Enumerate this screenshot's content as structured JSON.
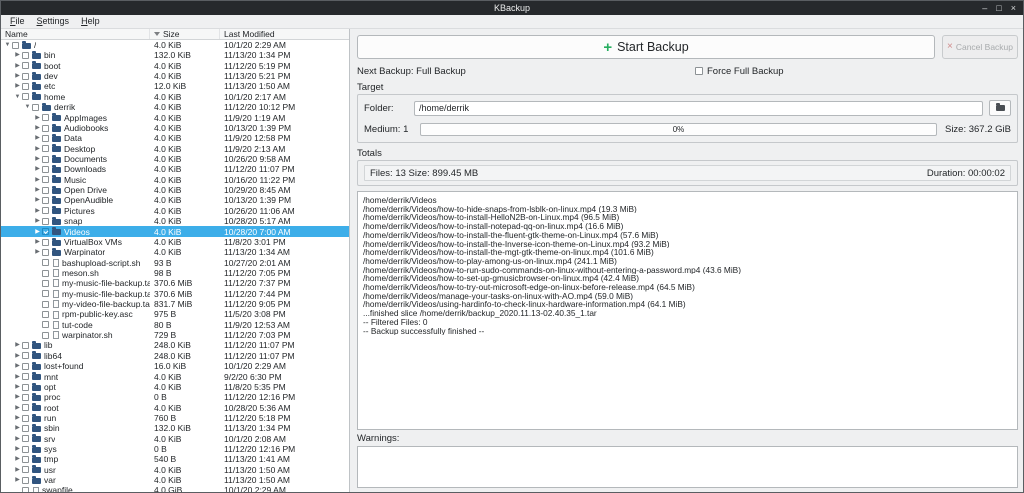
{
  "window": {
    "title": "KBackup",
    "controls": {
      "minimize": "–",
      "maximize": "□",
      "close": "×"
    }
  },
  "menu": {
    "items": [
      "File",
      "Settings",
      "Help"
    ]
  },
  "icons": {
    "plus": "+",
    "cancel_x": "×",
    "open_arrow": "▼",
    "closed_arrow": "▶"
  },
  "tree": {
    "columns": {
      "name": "Name",
      "size": "Size",
      "modified": "Last Modified"
    },
    "rows": [
      {
        "name": "/",
        "size": "4.0 KiB",
        "modified": "10/1/20 2:29 AM",
        "depth": 0,
        "arrow": "open",
        "kind": "dir",
        "checked": false,
        "selected": false
      },
      {
        "name": "bin",
        "size": "132.0 KiB",
        "modified": "11/13/20 1:34 PM",
        "depth": 1,
        "arrow": "closed",
        "kind": "dir",
        "checked": false,
        "selected": false
      },
      {
        "name": "boot",
        "size": "4.0 KiB",
        "modified": "11/12/20 5:19 PM",
        "depth": 1,
        "arrow": "closed",
        "kind": "dir",
        "checked": false,
        "selected": false
      },
      {
        "name": "dev",
        "size": "4.0 KiB",
        "modified": "11/13/20 5:21 PM",
        "depth": 1,
        "arrow": "closed",
        "kind": "dir",
        "checked": false,
        "selected": false
      },
      {
        "name": "etc",
        "size": "12.0 KiB",
        "modified": "11/13/20 1:50 AM",
        "depth": 1,
        "arrow": "closed",
        "kind": "dir",
        "checked": false,
        "selected": false
      },
      {
        "name": "home",
        "size": "4.0 KiB",
        "modified": "10/1/20 2:17 AM",
        "depth": 1,
        "arrow": "open",
        "kind": "dir",
        "checked": false,
        "selected": false
      },
      {
        "name": "derrik",
        "size": "4.0 KiB",
        "modified": "11/12/20 10:12 PM",
        "depth": 2,
        "arrow": "open",
        "kind": "dir",
        "checked": false,
        "selected": false
      },
      {
        "name": "AppImages",
        "size": "4.0 KiB",
        "modified": "11/9/20 1:19 AM",
        "depth": 3,
        "arrow": "closed",
        "kind": "dir",
        "checked": false,
        "selected": false
      },
      {
        "name": "Audiobooks",
        "size": "4.0 KiB",
        "modified": "10/13/20 1:39 PM",
        "depth": 3,
        "arrow": "closed",
        "kind": "dir",
        "checked": false,
        "selected": false
      },
      {
        "name": "Data",
        "size": "4.0 KiB",
        "modified": "11/9/20 12:58 PM",
        "depth": 3,
        "arrow": "closed",
        "kind": "dir",
        "checked": false,
        "selected": false
      },
      {
        "name": "Desktop",
        "size": "4.0 KiB",
        "modified": "11/9/20 2:13 AM",
        "depth": 3,
        "arrow": "closed",
        "kind": "dir",
        "checked": false,
        "selected": false
      },
      {
        "name": "Documents",
        "size": "4.0 KiB",
        "modified": "10/26/20 9:58 AM",
        "depth": 3,
        "arrow": "closed",
        "kind": "dir",
        "checked": false,
        "selected": false
      },
      {
        "name": "Downloads",
        "size": "4.0 KiB",
        "modified": "11/12/20 11:07 PM",
        "depth": 3,
        "arrow": "closed",
        "kind": "dir",
        "checked": false,
        "selected": false
      },
      {
        "name": "Music",
        "size": "4.0 KiB",
        "modified": "10/16/20 11:22 PM",
        "depth": 3,
        "arrow": "closed",
        "kind": "dir",
        "checked": false,
        "selected": false
      },
      {
        "name": "Open Drive",
        "size": "4.0 KiB",
        "modified": "10/29/20 8:45 AM",
        "depth": 3,
        "arrow": "closed",
        "kind": "dir",
        "checked": false,
        "selected": false
      },
      {
        "name": "OpenAudible",
        "size": "4.0 KiB",
        "modified": "10/13/20 1:39 PM",
        "depth": 3,
        "arrow": "closed",
        "kind": "dir",
        "checked": false,
        "selected": false
      },
      {
        "name": "Pictures",
        "size": "4.0 KiB",
        "modified": "10/26/20 11:06 AM",
        "depth": 3,
        "arrow": "closed",
        "kind": "dir",
        "checked": false,
        "selected": false
      },
      {
        "name": "snap",
        "size": "4.0 KiB",
        "modified": "10/28/20 5:17 AM",
        "depth": 3,
        "arrow": "closed",
        "kind": "dir",
        "checked": false,
        "selected": false
      },
      {
        "name": "Videos",
        "size": "4.0 KiB",
        "modified": "10/28/20 7:00 AM",
        "depth": 3,
        "arrow": "closed",
        "kind": "dir",
        "checked": true,
        "selected": true
      },
      {
        "name": "VirtualBox VMs",
        "size": "4.0 KiB",
        "modified": "11/8/20 3:01 PM",
        "depth": 3,
        "arrow": "closed",
        "kind": "dir",
        "checked": false,
        "selected": false
      },
      {
        "name": "Warpinator",
        "size": "4.0 KiB",
        "modified": "11/13/20 1:34 AM",
        "depth": 3,
        "arrow": "closed",
        "kind": "dir",
        "checked": false,
        "selected": false
      },
      {
        "name": "bashupload-script.sh",
        "size": "93 B",
        "modified": "10/27/20 2:01 AM",
        "depth": 3,
        "arrow": "none",
        "kind": "file",
        "checked": false,
        "selected": false
      },
      {
        "name": "meson.sh",
        "size": "98 B",
        "modified": "11/12/20 7:05 PM",
        "depth": 3,
        "arrow": "none",
        "kind": "file",
        "checked": false,
        "selected": false
      },
      {
        "name": "my-music-file-backup.tar.gz",
        "size": "370.6 MiB",
        "modified": "11/12/20 7:37 PM",
        "depth": 3,
        "arrow": "none",
        "kind": "file",
        "checked": false,
        "selected": false
      },
      {
        "name": "my-music-file-backup.tar.gz.gpg",
        "size": "370.6 MiB",
        "modified": "11/12/20 7:44 PM",
        "depth": 3,
        "arrow": "none",
        "kind": "file",
        "checked": false,
        "selected": false
      },
      {
        "name": "my-video-file-backup.tar.gz",
        "size": "831.7 MiB",
        "modified": "11/12/20 9:05 PM",
        "depth": 3,
        "arrow": "none",
        "kind": "file",
        "checked": false,
        "selected": false
      },
      {
        "name": "rpm-public-key.asc",
        "size": "975 B",
        "modified": "11/5/20 3:08 PM",
        "depth": 3,
        "arrow": "none",
        "kind": "file",
        "checked": false,
        "selected": false
      },
      {
        "name": "tut-code",
        "size": "80 B",
        "modified": "11/9/20 12:53 AM",
        "depth": 3,
        "arrow": "none",
        "kind": "file",
        "checked": false,
        "selected": false
      },
      {
        "name": "warpinator.sh",
        "size": "729 B",
        "modified": "11/12/20 7:03 PM",
        "depth": 3,
        "arrow": "none",
        "kind": "file",
        "checked": false,
        "selected": false
      },
      {
        "name": "lib",
        "size": "248.0 KiB",
        "modified": "11/12/20 11:07 PM",
        "depth": 1,
        "arrow": "closed",
        "kind": "dir",
        "checked": false,
        "selected": false
      },
      {
        "name": "lib64",
        "size": "248.0 KiB",
        "modified": "11/12/20 11:07 PM",
        "depth": 1,
        "arrow": "closed",
        "kind": "dir",
        "checked": false,
        "selected": false
      },
      {
        "name": "lost+found",
        "size": "16.0 KiB",
        "modified": "10/1/20 2:29 AM",
        "depth": 1,
        "arrow": "closed",
        "kind": "dir",
        "checked": false,
        "selected": false
      },
      {
        "name": "mnt",
        "size": "4.0 KiB",
        "modified": "9/2/20 6:30 PM",
        "depth": 1,
        "arrow": "closed",
        "kind": "dir",
        "checked": false,
        "selected": false
      },
      {
        "name": "opt",
        "size": "4.0 KiB",
        "modified": "11/8/20 5:35 PM",
        "depth": 1,
        "arrow": "closed",
        "kind": "dir",
        "checked": false,
        "selected": false
      },
      {
        "name": "proc",
        "size": "0 B",
        "modified": "11/12/20 12:16 PM",
        "depth": 1,
        "arrow": "closed",
        "kind": "dir",
        "checked": false,
        "selected": false
      },
      {
        "name": "root",
        "size": "4.0 KiB",
        "modified": "10/28/20 5:36 AM",
        "depth": 1,
        "arrow": "closed",
        "kind": "dir",
        "checked": false,
        "selected": false
      },
      {
        "name": "run",
        "size": "760 B",
        "modified": "11/12/20 5:18 PM",
        "depth": 1,
        "arrow": "closed",
        "kind": "dir",
        "checked": false,
        "selected": false
      },
      {
        "name": "sbin",
        "size": "132.0 KiB",
        "modified": "11/13/20 1:34 PM",
        "depth": 1,
        "arrow": "closed",
        "kind": "dir",
        "checked": false,
        "selected": false
      },
      {
        "name": "srv",
        "size": "4.0 KiB",
        "modified": "10/1/20 2:08 AM",
        "depth": 1,
        "arrow": "closed",
        "kind": "dir",
        "checked": false,
        "selected": false
      },
      {
        "name": "sys",
        "size": "0 B",
        "modified": "11/12/20 12:16 PM",
        "depth": 1,
        "arrow": "closed",
        "kind": "dir",
        "checked": false,
        "selected": false
      },
      {
        "name": "tmp",
        "size": "540 B",
        "modified": "11/13/20 1:41 AM",
        "depth": 1,
        "arrow": "closed",
        "kind": "dir",
        "checked": false,
        "selected": false
      },
      {
        "name": "usr",
        "size": "4.0 KiB",
        "modified": "11/13/20 1:50 AM",
        "depth": 1,
        "arrow": "closed",
        "kind": "dir",
        "checked": false,
        "selected": false
      },
      {
        "name": "var",
        "size": "4.0 KiB",
        "modified": "11/13/20 1:50 AM",
        "depth": 1,
        "arrow": "closed",
        "kind": "dir",
        "checked": false,
        "selected": false
      },
      {
        "name": "swapfile",
        "size": "4.0 GiB",
        "modified": "10/1/20 2:29 AM",
        "depth": 1,
        "arrow": "none",
        "kind": "file",
        "checked": false,
        "selected": false
      }
    ]
  },
  "panel": {
    "start_button": "Start Backup",
    "cancel_button": "Cancel Backup",
    "next_backup": "Next Backup: Full Backup",
    "force_full": "Force Full Backup",
    "target": {
      "title": "Target",
      "folder_label": "Folder:",
      "folder_value": "/home/derrik",
      "medium_label": "Medium: 1",
      "progress_text": "0%",
      "size_text": "Size: 367.2 GiB"
    },
    "totals": {
      "title": "Totals",
      "files_text": "Files: 13  Size: 899.45 MB",
      "duration_text": "Duration: 00:00:02"
    },
    "log_lines": [
      "/home/derrik/Videos",
      "/home/derrik/Videos/how-to-hide-snaps-from-lsblk-on-linux.mp4 (19.3 MiB)",
      "/home/derrik/Videos/how-to-install-HelloN2B-on-Linux.mp4 (96.5 MiB)",
      "/home/derrik/Videos/how-to-install-notepad-qq-on-linux.mp4 (16.6 MiB)",
      "/home/derrik/Videos/how-to-install-the-fluent-gtk-theme-on-Linux.mp4 (57.6 MiB)",
      "/home/derrik/Videos/how-to-install-the-Inverse-icon-theme-on-Linux.mp4 (93.2 MiB)",
      "/home/derrik/Videos/how-to-install-the-mgt-gtk-theme-on-linux.mp4 (101.6 MiB)",
      "/home/derrik/Videos/how-to-play-among-us-on-linux.mp4 (241.1 MiB)",
      "/home/derrik/Videos/how-to-run-sudo-commands-on-linux-without-entering-a-password.mp4 (43.6 MiB)",
      "/home/derrik/Videos/how-to-set-up-gmusicbrowser-on-linux.mp4 (42.4 MiB)",
      "/home/derrik/Videos/how-to-try-out-microsoft-edge-on-linux-before-release.mp4 (64.5 MiB)",
      "/home/derrik/Videos/manage-your-tasks-on-linux-with-AO.mp4 (59.0 MiB)",
      "/home/derrik/Videos/using-hardinfo-to-check-linux-hardware-information.mp4 (64.1 MiB)",
      "...finished slice /home/derrik/backup_2020.11.13-02.40.35_1.tar",
      "-- Filtered Files: 0",
      "-- Backup successfully finished --"
    ],
    "warnings_label": "Warnings:"
  },
  "colors": {
    "accent": "#3daee9",
    "success": "#27ae60",
    "titlebar": "#26292c",
    "selection_text": "#ffffff"
  }
}
